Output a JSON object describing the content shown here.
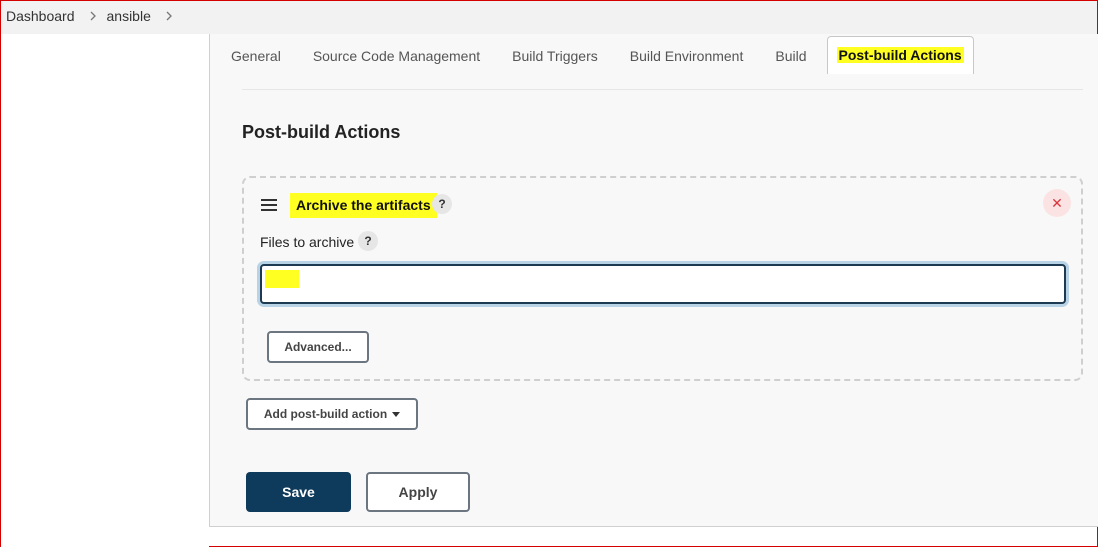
{
  "breadcrumb": [
    {
      "label": "Dashboard"
    },
    {
      "label": "ansible"
    }
  ],
  "tabs": [
    {
      "label": "General"
    },
    {
      "label": "Source Code Management"
    },
    {
      "label": "Build Triggers"
    },
    {
      "label": "Build Environment"
    },
    {
      "label": "Build"
    },
    {
      "label": "Post-build Actions",
      "active": true
    }
  ],
  "section": {
    "title": "Post-build Actions"
  },
  "archive": {
    "title": "Archive the artifacts",
    "help": "?",
    "files_label": "Files to archive",
    "files_help": "?",
    "files_value": "**",
    "advanced_label": "Advanced...",
    "remove_icon": "close-icon"
  },
  "add_action_label": "Add post-build action",
  "buttons": {
    "save": "Save",
    "apply": "Apply"
  },
  "colors": {
    "highlight": "#ffff22",
    "primary": "#0e3a5b",
    "border_red": "#d40000",
    "remove_bg": "#fbe3e3",
    "remove_fg": "#d9363e"
  }
}
